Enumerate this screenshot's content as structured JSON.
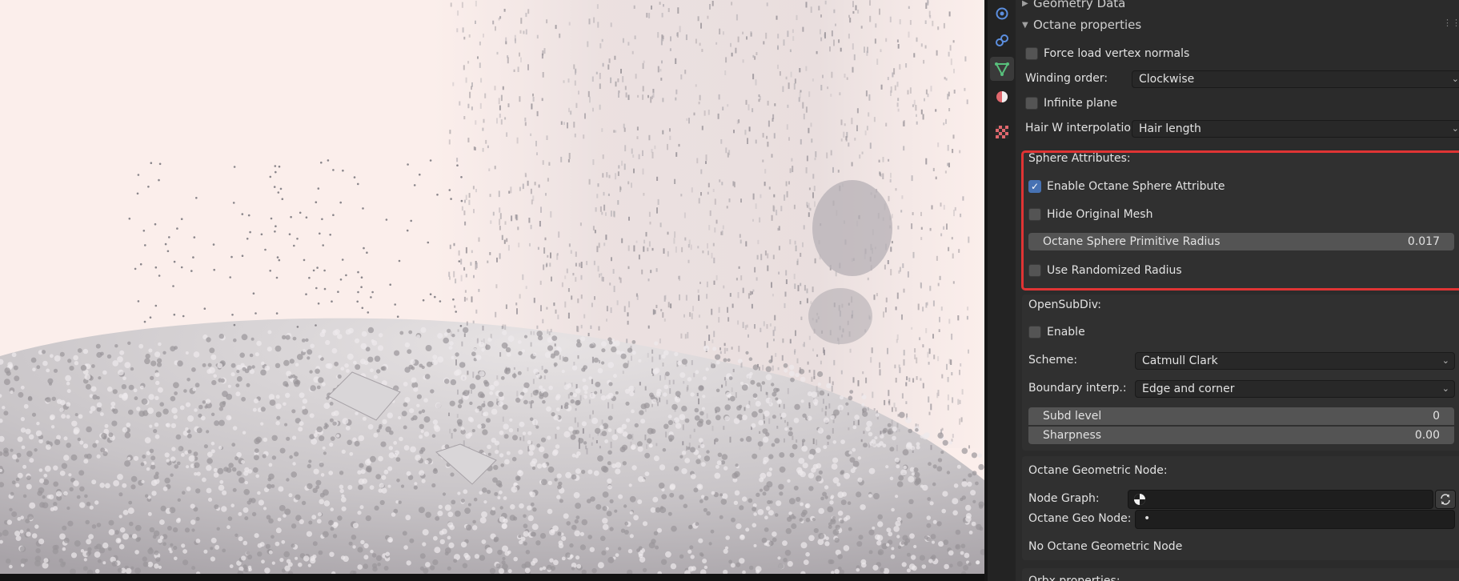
{
  "tabs": [
    {
      "name": "physics-icon",
      "color": "#5c8fe0"
    },
    {
      "name": "constraints-icon",
      "color": "#5c8fe0"
    },
    {
      "name": "data-icon",
      "color": "#58c07c",
      "active": true
    },
    {
      "name": "material-icon",
      "color": "#e0676d"
    },
    {
      "name": "texture-icon",
      "color": "#e0676d"
    }
  ],
  "panel": {
    "geometry_data_label": "Geometry Data",
    "octane_properties_label": "Octane properties",
    "force_load_vertex_normals": {
      "label": "Force load vertex normals",
      "checked": false
    },
    "winding_order": {
      "label": "Winding order:",
      "value": "Clockwise"
    },
    "infinite_plane": {
      "label": "Infinite plane",
      "checked": false
    },
    "hair_w_interpolation": {
      "label": "Hair W interpolation:",
      "value": "Hair length"
    },
    "sphere_attributes": {
      "title": "Sphere Attributes:",
      "enable": {
        "label": "Enable Octane Sphere Attribute",
        "checked": true
      },
      "hide_original": {
        "label": "Hide Original Mesh",
        "checked": false
      },
      "radius": {
        "label": "Octane Sphere Primitive Radius",
        "value": "0.017"
      },
      "randomized": {
        "label": "Use Randomized Radius",
        "checked": false
      }
    },
    "opensubdiv": {
      "title": "OpenSubDiv:",
      "enable": {
        "label": "Enable",
        "checked": false
      },
      "scheme": {
        "label": "Scheme:",
        "value": "Catmull Clark"
      },
      "boundary": {
        "label": "Boundary interp.:",
        "value": "Edge and corner"
      },
      "subd_level": {
        "label": "Subd level",
        "value": "0"
      },
      "sharpness": {
        "label": "Sharpness",
        "value": "0.00"
      }
    },
    "geometric_node": {
      "title": "Octane Geometric Node:",
      "node_graph_label": "Node Graph:",
      "geo_node_label": "Octane Geo Node:",
      "status": "No Octane Geometric Node"
    },
    "orbx_label": "Orbx properties:"
  },
  "accent_color": "#4772b3",
  "highlight_color": "#e03434"
}
